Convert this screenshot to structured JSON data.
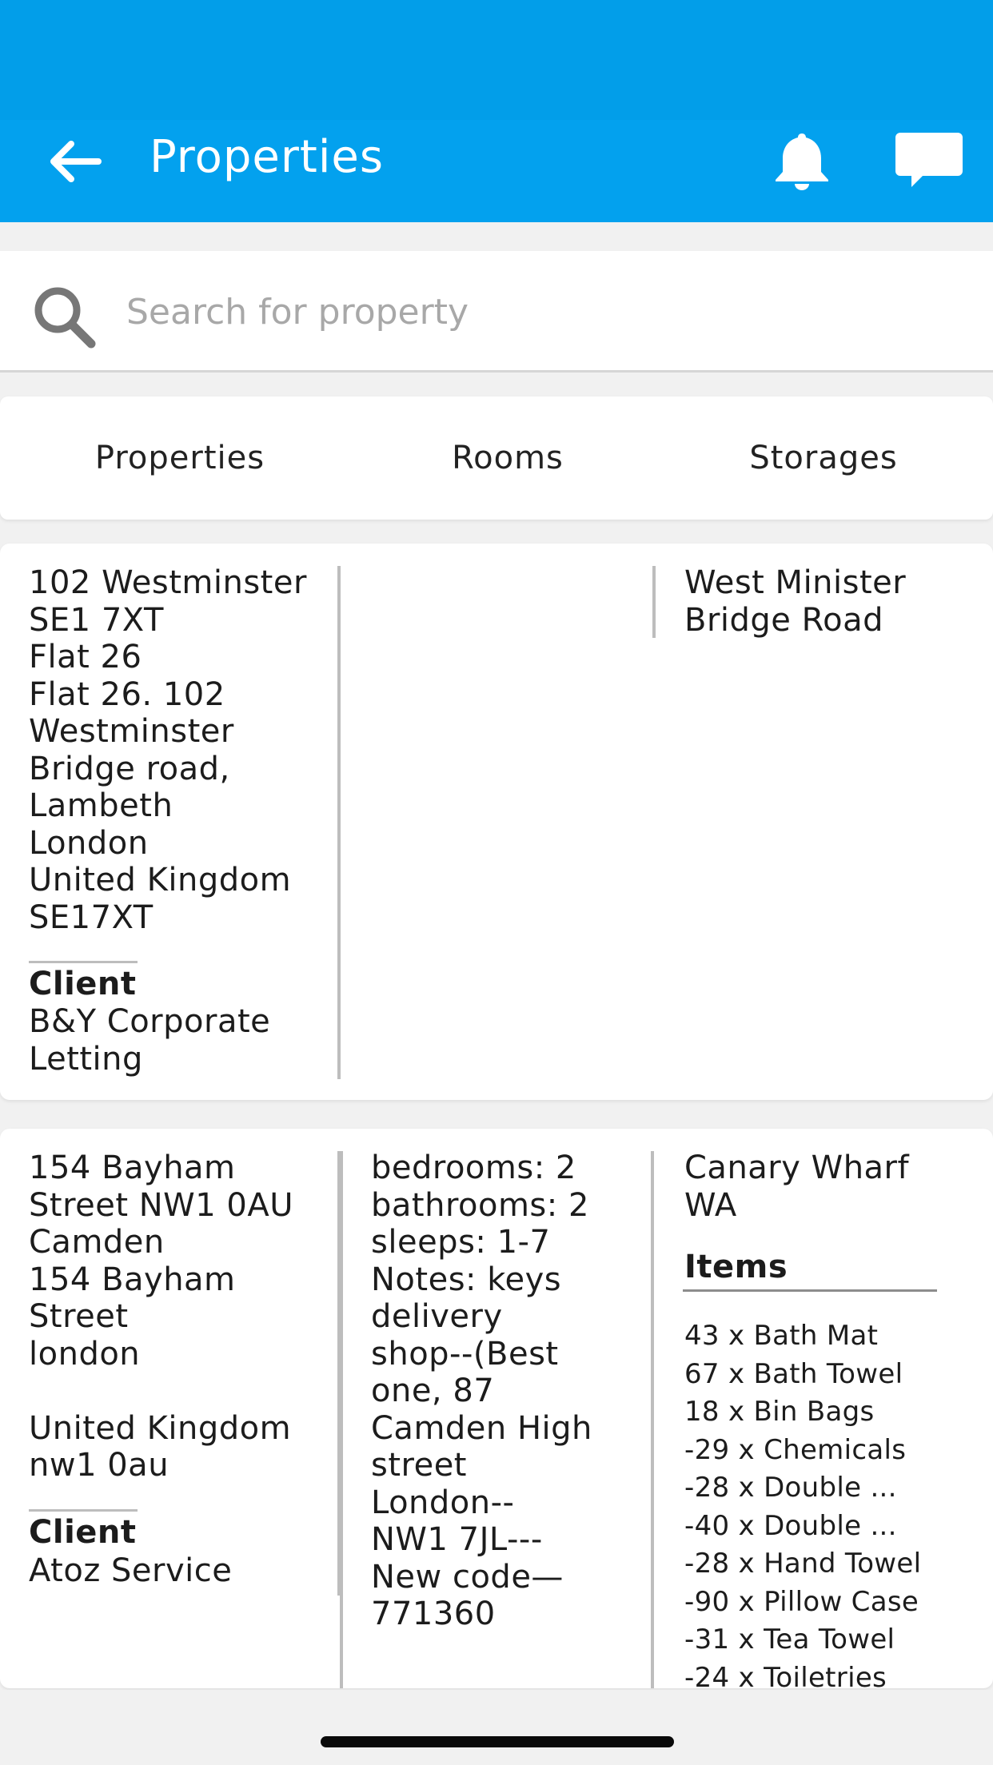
{
  "header": {
    "title": "Properties",
    "back_icon": "arrow-left-icon",
    "notification_icon": "bell-icon",
    "messages_icon": "chat-bubble-icon",
    "background_color": "#03a1ee"
  },
  "search": {
    "placeholder": "Search for property",
    "value": "",
    "icon": "search-icon"
  },
  "tabs": [
    {
      "label": "Properties"
    },
    {
      "label": "Rooms"
    },
    {
      "label": "Storages"
    }
  ],
  "properties": [
    {
      "address": "102 Westminster\nSE1 7XT\nFlat 26\nFlat 26. 102\nWestminster\nBridge road,\nLambeth\nLondon\nUnited Kingdom\nSE17XT",
      "client_label": "Client",
      "client_name": "B&Y Corporate Letting",
      "details": "",
      "location": "West Minister\nBridge Road"
    },
    {
      "address": "154 Bayham\nStreet NW1 0AU\nCamden\n154 Bayham\nStreet\nlondon\n\nUnited Kingdom\nnw1 0au",
      "client_label": "Client",
      "client_name": "Atoz Service",
      "details": "bedrooms: 2\nbathrooms: 2\nsleeps: 1-7\nNotes: keys\ndelivery\nshop--(Best\none, 87\nCamden High\nstreet\nLondon--\nNW1 7JL---\nNew code—\n771360",
      "location": "Canary Wharf\nWA",
      "items_title": "Items",
      "items": [
        "43 x Bath Mat",
        "67 x Bath Towel",
        "18 x Bin Bags",
        "-29 x Chemicals",
        "-28 x Double ...",
        "-40 x Double ...",
        "-28 x Hand Towel",
        "-90 x Pillow Case",
        "-31 x Tea Towel",
        "-24 x Toiletries"
      ]
    }
  ]
}
